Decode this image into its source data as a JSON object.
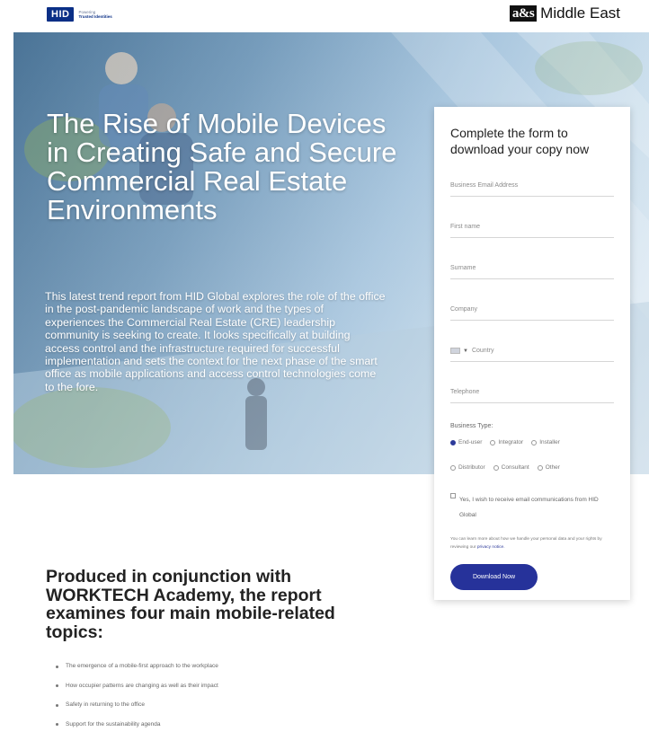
{
  "header": {
    "hid_logo": "HID",
    "hid_tagline_1": "Powering",
    "hid_tagline_2": "Trusted Identities",
    "asm_mark": "a&s",
    "asm_text": "Middle East"
  },
  "hero": {
    "title": "The Rise of Mobile Devices in Creating Safe and Secure Commercial Real Estate Environments",
    "body": "This latest trend report from HID Global explores the role of the office in the post-pandemic landscape of work and the types of experiences the Commercial Real Estate (CRE) leadership community is seeking to create. It looks specifically at building access control and the infrastructure required for successful implementation and sets the context for the next phase of the smart office as mobile applications and access control technologies come to the fore."
  },
  "form": {
    "title": "Complete the form to download your copy now",
    "fields": {
      "email": "Business Email Address",
      "first_name": "First name",
      "surname": "Surname",
      "company": "Company",
      "country": "Country",
      "telephone": "Telephone"
    },
    "business_type_label": "Business Type:",
    "business_types": [
      "End-user",
      "Integrator",
      "Installer",
      "Distributor",
      "Consultant",
      "Other"
    ],
    "selected_business_type": "End-user",
    "consent_text": "Yes, I wish to receive email communications from HID Global",
    "privacy_text": "You can learn more about how we handle your personal data and your rights by reviewing our",
    "privacy_link": "privacy notice.",
    "download_label": "Download Now"
  },
  "lower": {
    "heading": "Produced in conjunction with WORKTECH Academy, the report examines four main mobile-related topics:",
    "topics": [
      "The emergence of a mobile-first approach to the workplace",
      "How occupier patterns are changing as well as their impact",
      "Safety in returning to the office",
      "Support for the sustainability agenda"
    ]
  },
  "colors": {
    "hid_blue": "#0a2f86",
    "button_blue": "#26329a",
    "hero_light": "#c5dbeb"
  }
}
